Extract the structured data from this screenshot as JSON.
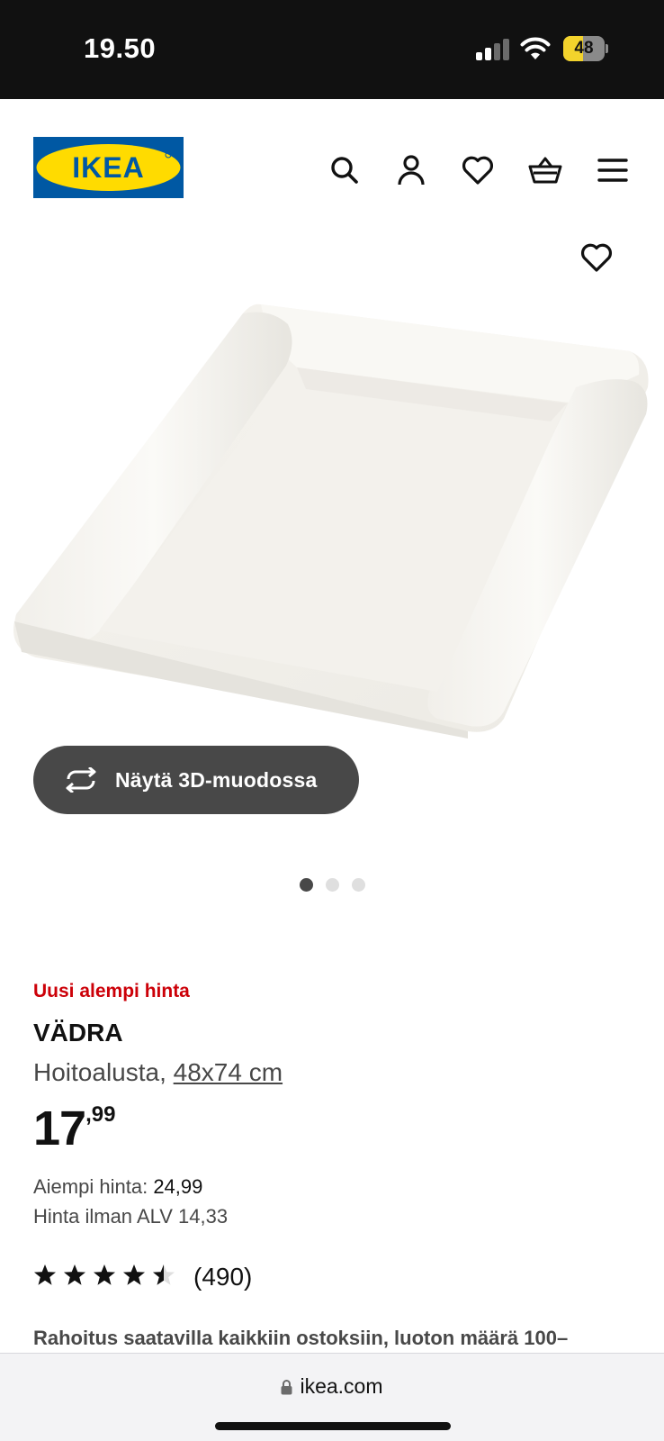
{
  "status_bar": {
    "time": "19.50",
    "battery": "48",
    "battery_level": 0.48
  },
  "header": {
    "logo_text": "IKEA",
    "icons": [
      "search-icon",
      "account-icon",
      "heart-icon",
      "basket-icon",
      "menu-icon"
    ]
  },
  "gallery": {
    "view_3d_label": "Näytä 3D-muodossa",
    "image_count": 3,
    "active_index": 0
  },
  "product": {
    "badge": "Uusi alempi hinta",
    "name": "VÄDRA",
    "type": "Hoitoalusta,",
    "size": "48x74 cm",
    "price_int": "17",
    "price_dec": ",99",
    "previous_price_label": "Aiempi hinta:",
    "previous_price_value": "24,99",
    "vat_text": "Hinta ilman ALV 14,33",
    "rating_value": 4.5,
    "rating_max": 5,
    "review_count": "(490)",
    "finance_text": "Rahoitus saatavilla kaikkiin ostoksiin, luoton määrä 100–"
  },
  "browser": {
    "url": "ikea.com"
  },
  "colors": {
    "ikea_blue": "#0058a3",
    "ikea_yellow": "#ffdb00",
    "price_red": "#cc0008",
    "button_dark": "#484848"
  }
}
